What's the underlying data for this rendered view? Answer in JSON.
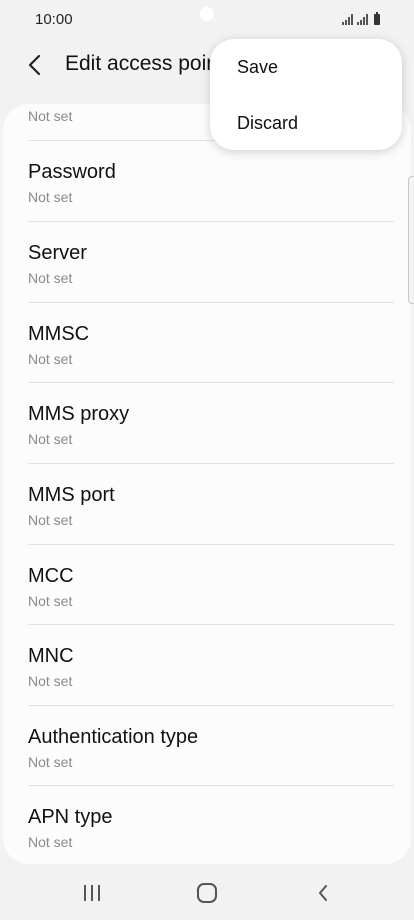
{
  "status": {
    "time": "10:00",
    "icons": [
      "signal-icon",
      "signal-icon",
      "battery-icon"
    ]
  },
  "appbar": {
    "title": "Edit access point",
    "back_icon": "back-arrow-icon"
  },
  "menu": {
    "items": [
      {
        "label": "Save"
      },
      {
        "label": "Discard"
      }
    ]
  },
  "settings": {
    "top_partial_value": "Not set",
    "items": [
      {
        "label": "Password",
        "value": "Not set"
      },
      {
        "label": "Server",
        "value": "Not set"
      },
      {
        "label": "MMSC",
        "value": "Not set"
      },
      {
        "label": "MMS proxy",
        "value": "Not set"
      },
      {
        "label": "MMS port",
        "value": "Not set"
      },
      {
        "label": "MCC",
        "value": "Not set"
      },
      {
        "label": "MNC",
        "value": "Not set"
      },
      {
        "label": "Authentication type",
        "value": "Not set"
      },
      {
        "label": "APN type",
        "value": "Not set"
      }
    ]
  },
  "navbar": {
    "buttons": [
      "recents-icon",
      "home-icon",
      "back-icon"
    ]
  }
}
